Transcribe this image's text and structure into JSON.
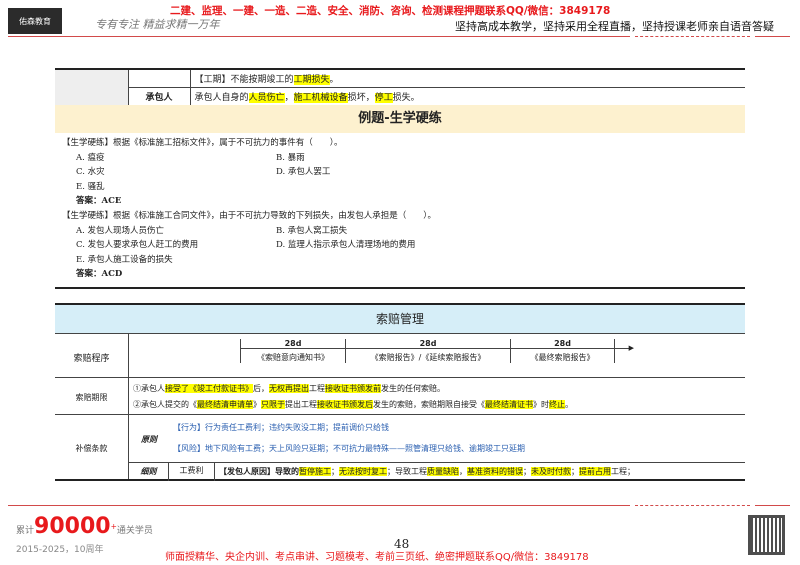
{
  "header": {
    "logo": "佑森教育",
    "slogan": "专有专注 精益求精一万年",
    "top_red": "二建、监理、一建、一造、二造、安全、消防、咨询、检测课程押题联系QQ/微信：3849178",
    "right_text": "坚持高成本教学，坚持采用全程直播，坚持授课老师亲自语音答疑"
  },
  "table1": {
    "row1": {
      "pre": "【工期】不能按期竣工的",
      "hl": "工期损失",
      "post": "。"
    },
    "row2": {
      "label": "承包人",
      "t1": "承包人自身的",
      "h1": "人员伤亡",
      "t2": "，",
      "h2": "施工机械设备",
      "t3": "损坏，",
      "h3": "停工",
      "t4": "损失。"
    }
  },
  "example_title": "例题-生学硬练",
  "q1": {
    "stem": "【生学硬练】根据《标准施工招标文件》，属于不可抗力的事件有（　　）。",
    "options": [
      "A. 瘟疫",
      "B. 暴雨",
      "C. 水灾",
      "D. 承包人罢工",
      "E. 骚乱"
    ],
    "answer": "答案：ACE"
  },
  "q2": {
    "stem": "【生学硬练】根据《标准施工合同文件》，由于不可抗力导致的下列损失，由发包人承担是（　　）。",
    "options": [
      "A. 发包人现场人员伤亡",
      "B. 承包人窝工损失",
      "C. 发包人要求承包人赶工的费用",
      "D. 监理人指示承包人清理场地的费用",
      "E. 承包人施工设备的损失"
    ],
    "answer": "答案：ACD"
  },
  "claims": {
    "title": "索赔管理",
    "procedure": {
      "label": "索赔程序",
      "steps": [
        {
          "days": "28d",
          "doc": "《索赔意向通知书》"
        },
        {
          "days": "28d",
          "doc": "《索赔报告》/《延续索赔报告》"
        },
        {
          "days": "28d",
          "doc": "《最终索赔报告》"
        }
      ]
    },
    "deadline": {
      "label": "索赔期限",
      "l1": [
        "①承包人",
        "接受了",
        "《竣工付款证书》",
        "后，",
        "无权再提出",
        "工程",
        "接收证书颁发前",
        "发生的任何索赔。"
      ],
      "l2": [
        "②承包人提交的《",
        "最终结清申请单",
        "》",
        "只限于",
        "提出工程",
        "接收证书颁发后",
        "发生的索赔，索赔期限自接受《",
        "最终结清证书",
        "》时",
        "终止",
        "。"
      ]
    },
    "compensation": {
      "label": "补偿条款",
      "principle_label": "原则",
      "p1": "【行为】行为责任工费利；违约失败没工期；提前调价只给钱",
      "p2": "【风险】地下风险有工费；天上风险只延期；不可抗力最特殊——照管清理只给钱、逾期竣工只延期",
      "detail_label": "细则",
      "detail_type": "工费利",
      "detail": [
        "【发包人原因】导致的",
        "暂停施工",
        "；",
        "无法按时复工",
        "；导致工程",
        "质量缺陷",
        "，",
        "基准资料的错误",
        "；",
        "未及时付款",
        "；",
        "提前占用",
        "工程；"
      ]
    }
  },
  "footer": {
    "count_pre": "累计",
    "count": "90000",
    "count_sup": "+",
    "count_post": "通关学员",
    "years": "2015-2025，10周年",
    "page": "48",
    "red": "师面授精华、央企内训、考点串讲、习题模考、考前三页纸、绝密押题联系QQ/微信：3849178"
  },
  "colors": {
    "red": "#e8191c",
    "highlight": "#ffff00",
    "title_bg": "#fdf1cf",
    "blue_bg": "#d6eef8"
  }
}
